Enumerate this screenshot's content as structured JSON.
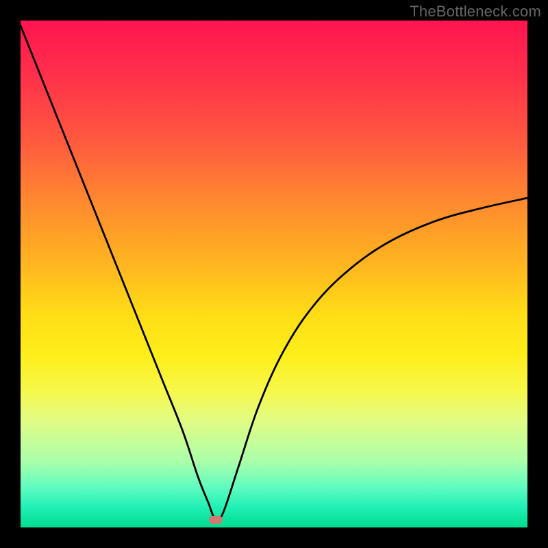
{
  "watermark": "TheBottleneck.com",
  "chart_data": {
    "type": "line",
    "title": "",
    "xlabel": "",
    "ylabel": "",
    "xlim": [
      0,
      100
    ],
    "ylim": [
      0,
      100
    ],
    "grid": false,
    "legend": false,
    "background": "rainbow-gradient (red top → green bottom, representing bottleneck severity)",
    "series": [
      {
        "name": "bottleneck-curve",
        "x": [
          0,
          4,
          8,
          12,
          16,
          20,
          24,
          28,
          32,
          35,
          37,
          38.5,
          40,
          43,
          47,
          52,
          58,
          65,
          73,
          82,
          91,
          100
        ],
        "y": [
          99,
          89,
          79,
          69,
          59,
          49,
          39,
          29,
          19,
          10,
          5,
          1.5,
          3,
          12,
          24,
          35,
          44,
          51,
          56.5,
          60.5,
          63,
          65
        ]
      }
    ],
    "marker": {
      "shape": "rounded-pill",
      "x": 38.5,
      "y": 1.5,
      "color": "#cd7a73"
    },
    "colors": {
      "curve": "#000000",
      "frame": "#000000",
      "gradient_top": "#ff1450",
      "gradient_bottom": "#00db8e"
    }
  }
}
